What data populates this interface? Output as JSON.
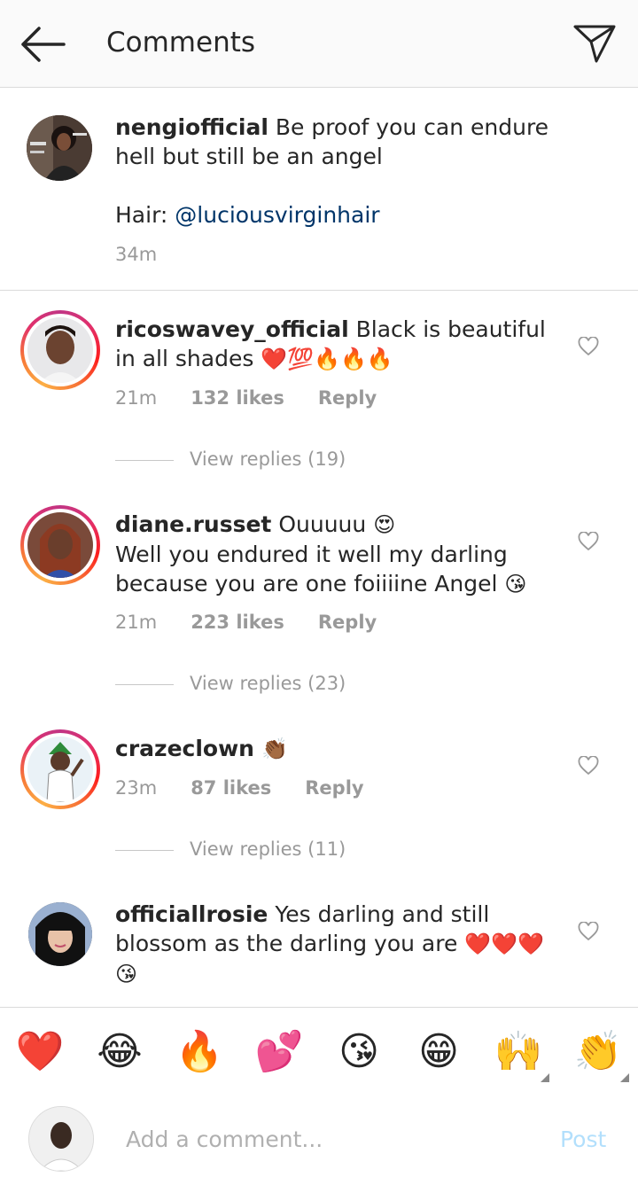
{
  "header": {
    "title": "Comments"
  },
  "caption": {
    "username": "nengiofficial",
    "text": "Be proof you can endure hell but still be an angel",
    "hair_label": "Hair:",
    "hair_mention": "@luciousvirginhair",
    "time": "34m"
  },
  "comments": [
    {
      "username": "ricoswavey_official",
      "text": "Black is beautiful in all shades",
      "emoji": "❤️💯🔥🔥🔥",
      "time": "21m",
      "likes": "132 likes",
      "reply": "Reply",
      "view_replies": "View replies (19)"
    },
    {
      "username": "diane.russet",
      "text": "Ouuuuu",
      "emoji": "😍",
      "text2": "Well you endured it well my darling because you are one foiiiine Angel",
      "emoji2": "😘",
      "time": "21m",
      "likes": "223 likes",
      "reply": "Reply",
      "view_replies": "View replies (23)"
    },
    {
      "username": "crazeclown",
      "emoji": "👏🏾",
      "time": "23m",
      "likes": "87 likes",
      "reply": "Reply",
      "view_replies": "View replies (11)"
    },
    {
      "username": "officiallrosie",
      "text": "Yes darling and still blossom as the darling you are",
      "emoji": "❤️❤️❤️",
      "emoji2": "😘"
    }
  ],
  "emoji_bar": [
    "❤️",
    "😂",
    "🔥",
    "💕",
    "😘",
    "😁",
    "🙌",
    "👏"
  ],
  "composer": {
    "placeholder": "Add a comment...",
    "post": "Post"
  },
  "colors": {
    "link": "#003569",
    "meta": "#999999",
    "post_disabled": "#b2dffc",
    "heart_emoji": "#e0245e"
  }
}
